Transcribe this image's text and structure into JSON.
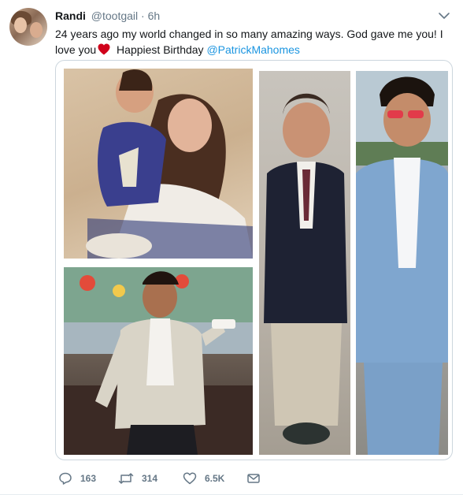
{
  "tweet": {
    "author_name": "Randi",
    "author_handle": "@tootgail",
    "separator": "·",
    "time": "6h",
    "text_part1": "24 years ago my world changed in so many amazing ways. God gave me you! I love you",
    "text_part2": " Happiest Birthday ",
    "mention": "@PatrickMahomes"
  },
  "media": {
    "photo_count": 4
  },
  "actions": {
    "reply_count": "163",
    "retweet_count": "314",
    "like_count": "6.5K"
  },
  "colors": {
    "link": "#1b95e0",
    "secondary_text": "#657786",
    "heart": "#e0245e"
  },
  "icons": [
    "reply-icon",
    "retweet-icon",
    "like-icon",
    "direct-message-icon",
    "chevron-down-icon",
    "red-heart-emoji"
  ]
}
